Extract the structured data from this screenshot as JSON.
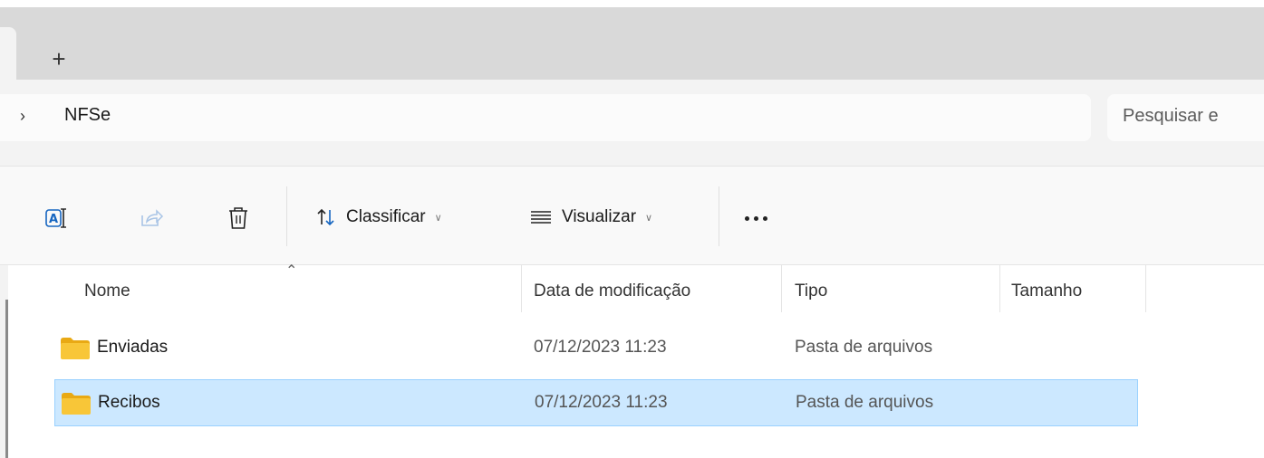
{
  "tabs": {
    "new_tab_label": "+"
  },
  "address_bar": {
    "chevron": "›",
    "breadcrumb": [
      "NFSe"
    ],
    "search_placeholder": "Pesquisar e"
  },
  "toolbar": {
    "rename_icon": "rename-icon",
    "share_icon": "share-icon",
    "delete_icon": "trash-icon",
    "sort_label": "Classificar",
    "view_label": "Visualizar",
    "more_label": "..."
  },
  "file_list": {
    "columns": [
      "Nome",
      "Data de modificação",
      "Tipo",
      "Tamanho"
    ],
    "rows": [
      {
        "name": "Enviadas",
        "modified": "07/12/2023 11:23",
        "type": "Pasta de arquivos",
        "size": "",
        "selected": false
      },
      {
        "name": "Recibos",
        "modified": "07/12/2023 11:23",
        "type": "Pasta de arquivos",
        "size": "",
        "selected": true
      }
    ]
  },
  "colors": {
    "selection_bg": "#cce8ff",
    "selection_border": "#99d1ff",
    "folder": "#f5c12e"
  }
}
